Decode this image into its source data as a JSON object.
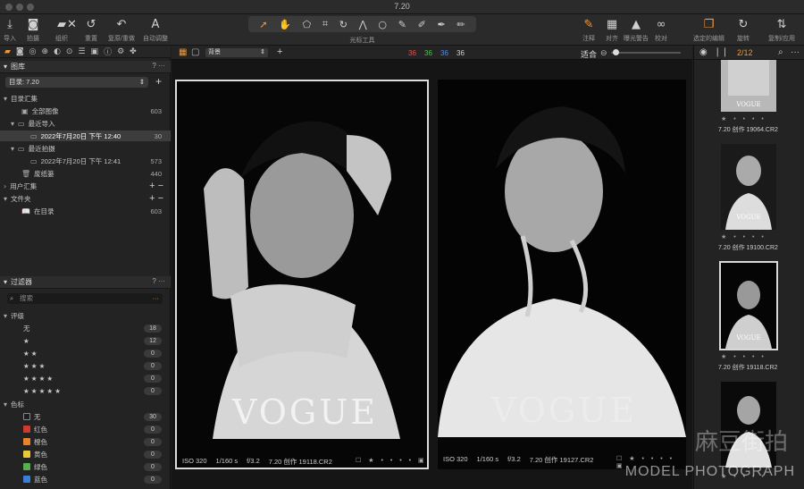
{
  "window": {
    "title": "7.20"
  },
  "toolbar": {
    "left_buttons": [
      {
        "icon": "import-icon",
        "glyph": "⤓",
        "label": "导入"
      },
      {
        "icon": "camera-icon",
        "glyph": "◙",
        "label": "拍摄"
      },
      {
        "icon": "folder-icon",
        "glyph": "▰",
        "label": "组织"
      },
      {
        "icon": "delete-icon",
        "glyph": "✕",
        "label": ""
      },
      {
        "icon": "reset-icon",
        "glyph": "↺",
        "label": "重置"
      },
      {
        "icon": "undo-icon",
        "glyph": "↶",
        "label": "复原/重做"
      },
      {
        "icon": "auto-adjust-icon",
        "glyph": "A",
        "label": "自动调整"
      }
    ],
    "cursor_tools_label": "光标工具",
    "right_buttons": [
      {
        "icon": "annotate-icon",
        "glyph": "✎",
        "label": "注释"
      },
      {
        "icon": "grid-icon",
        "glyph": "▦",
        "label": "对齐"
      },
      {
        "icon": "warning-icon",
        "glyph": "▲",
        "label": "曝光警告"
      },
      {
        "icon": "glasses-icon",
        "glyph": "∞",
        "label": "校对"
      },
      {
        "icon": "edit-selected-icon",
        "glyph": "❐",
        "label": "选定的编辑"
      },
      {
        "icon": "rotate-icon",
        "glyph": "↻",
        "label": "旋转"
      },
      {
        "icon": "copy-apply-icon",
        "glyph": "⇅",
        "label": "复制/应用"
      }
    ]
  },
  "library": {
    "header": "图库",
    "catalog": "目录: 7.20",
    "catalog_collections": "目录汇集",
    "items": [
      {
        "label": "全部图像",
        "count": "603"
      },
      {
        "label": "最近导入",
        "count": ""
      },
      {
        "label": "2022年7月20日 下午 12:40",
        "count": "30"
      },
      {
        "label": "最近拍摄",
        "count": ""
      },
      {
        "label": "2022年7月20日 下午 12:41",
        "count": "573"
      },
      {
        "label": "废纸篓",
        "count": "440"
      }
    ],
    "user_collections": "用户汇集",
    "folders": "文件夹",
    "in_catalog": {
      "label": "在目录",
      "count": "603"
    }
  },
  "filters": {
    "header": "过滤器",
    "search_placeholder": "搜索",
    "rating_title": "评级",
    "ratings": [
      {
        "label": "无",
        "count": "18"
      },
      {
        "label": "★",
        "count": "12"
      },
      {
        "label": "★ ★",
        "count": "0"
      },
      {
        "label": "★ ★ ★",
        "count": "0"
      },
      {
        "label": "★ ★ ★ ★",
        "count": "0"
      },
      {
        "label": "★ ★ ★ ★ ★",
        "count": "0"
      }
    ],
    "color_title": "色标",
    "colors": [
      {
        "label": "无",
        "count": "30",
        "color": "#1e1e1e"
      },
      {
        "label": "红色",
        "count": "0",
        "color": "#d23a2e"
      },
      {
        "label": "橙色",
        "count": "0",
        "color": "#e9822b"
      },
      {
        "label": "黄色",
        "count": "0",
        "color": "#e7c93a"
      },
      {
        "label": "绿色",
        "count": "0",
        "color": "#56b04a"
      },
      {
        "label": "蓝色",
        "count": "0",
        "color": "#3c7fd6"
      }
    ]
  },
  "viewer": {
    "background_select": "背景",
    "counts": [
      {
        "value": "36",
        "color": "#e05555"
      },
      {
        "value": "36",
        "color": "#58c05a"
      },
      {
        "value": "36",
        "color": "#5b8de0"
      },
      {
        "value": "36",
        "color": "#d0d0d0"
      }
    ],
    "fit_label": "适合",
    "photos": [
      {
        "iso": "ISO 320",
        "shutter": "1/160 s",
        "aperture": "f/3.2",
        "name": "7.20 创作 19118.CR2",
        "logo": "VOGUE"
      },
      {
        "iso": "ISO 320",
        "shutter": "1/160 s",
        "aperture": "f/3.2",
        "name": "7.20 创作 19127.CR2",
        "logo": "VOGUE"
      }
    ]
  },
  "browser": {
    "page": "2/12",
    "thumbs": [
      {
        "name": "7.20 创作 19064.CR2"
      },
      {
        "name": "7.20 创作 19100.CR2"
      },
      {
        "name": "7.20 创作 19118.CR2"
      },
      {
        "name": ""
      }
    ],
    "rating_dots": "★ • • • •"
  },
  "watermark": {
    "text": "MODEL PHOTOGRAPH",
    "logo_text": "麻豆街拍"
  }
}
